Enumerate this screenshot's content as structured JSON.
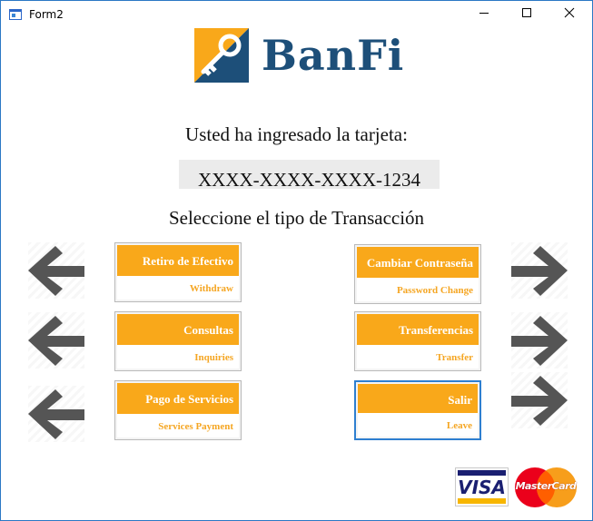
{
  "window": {
    "title": "Form2"
  },
  "header": {
    "brand": "BanFi"
  },
  "main": {
    "intro": "Usted ha ingresado la tarjeta:",
    "card_number": "XXXX-XXXX-XXXX-1234",
    "select_prompt": "Seleccione el tipo de Transacción"
  },
  "transactions": {
    "left": [
      {
        "label": "Retiro de Efectivo",
        "sublabel": "Withdraw"
      },
      {
        "label": "Consultas",
        "sublabel": "Inquiries"
      },
      {
        "label": "Pago de Servicios",
        "sublabel": "Services Payment"
      }
    ],
    "right": [
      {
        "label": "Cambiar Contraseña",
        "sublabel": "Password Change"
      },
      {
        "label": "Transferencias",
        "sublabel": "Transfer"
      },
      {
        "label": "Salir",
        "sublabel": "Leave"
      }
    ]
  },
  "footer": {
    "visa": "VISA",
    "mastercard": "MasterCard"
  },
  "colors": {
    "accent": "#f9a81a",
    "brand": "#1d4f79",
    "focus": "#2e7fd0"
  },
  "icons": [
    "key-logo-icon",
    "arrow-left-icon",
    "arrow-right-icon",
    "minimize-icon",
    "maximize-icon",
    "close-icon"
  ]
}
